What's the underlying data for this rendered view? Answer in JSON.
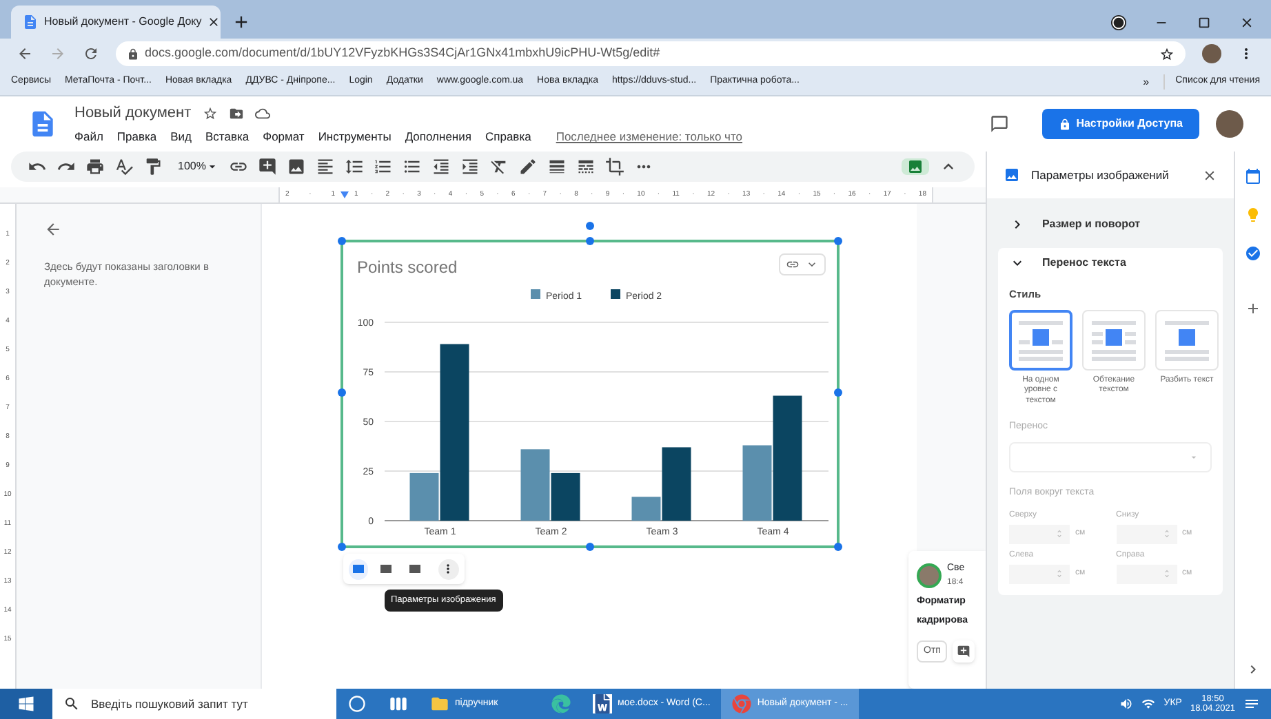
{
  "browser": {
    "tab": {
      "title": "Новый документ - Google Доку"
    },
    "url": "docs.google.com/document/d/1bUY12VFyzbKHGs3S4CjAr1GNx41mbxhU9icPHU-Wt5g/edit#",
    "bookmarks": [
      "Сервисы",
      "МетаПочта - Почт...",
      "Новая вкладка",
      "ДДУВС - Дніпропе...",
      "Login",
      "Додатки",
      "www.google.com.ua",
      "Нова вкладка",
      "https://dduvs-stud...",
      "Практична робота..."
    ],
    "more_bookmarks": "»",
    "reading_list": "Список для чтения"
  },
  "document": {
    "title": "Новый документ",
    "menu": [
      "Файл",
      "Правка",
      "Вид",
      "Вставка",
      "Формат",
      "Инструменты",
      "Дополнения",
      "Справка"
    ],
    "last_edit": "Последнее изменение: только что",
    "share_button": "Настройки Доступа"
  },
  "toolbar": {
    "zoom": "100%"
  },
  "ruler": {
    "top_margin": "2 · 1",
    "top": "1 · 2 · 3 · 4 · 5 · 6 · 7 · 8 · 9 · 10 · 11 · 12 · 13 · 14 · 15 · 16 · 17 · 18",
    "left": "1 2 3 4 5 6 7 8 9 10 11 12 13 14 15"
  },
  "outline": {
    "hint": "Здесь будут показаны заголовки в документе."
  },
  "chart": {
    "chart_data": {
      "type": "bar",
      "title": "Points scored",
      "categories": [
        "Team 1",
        "Team 2",
        "Team 3",
        "Team 4"
      ],
      "series": [
        {
          "name": "Period 1",
          "color": "#5b8fad",
          "values": [
            24,
            36,
            12,
            38
          ]
        },
        {
          "name": "Period 2",
          "color": "#0b4561",
          "values": [
            89,
            24,
            37,
            63
          ]
        }
      ],
      "ylim": [
        0,
        100
      ],
      "yticks": [
        0,
        25,
        50,
        75,
        100
      ],
      "grid": true,
      "legend": true
    }
  },
  "image_toolbar": {
    "wrap_options": [
      {
        "selected": true
      },
      {
        "selected": false
      },
      {
        "selected": false
      }
    ],
    "tooltip": "Параметры изображения"
  },
  "comment": {
    "author": "Све",
    "time": "18:4",
    "lines": [
      "Форматир",
      "кадрирова"
    ],
    "reply": "Отп"
  },
  "image_panel": {
    "title": "Параметры изображений",
    "sections": [
      {
        "label": "Размер и поворот",
        "expanded": false
      },
      {
        "label": "Перенос текста",
        "expanded": true
      }
    ],
    "style_label": "Стиль",
    "styles": [
      {
        "label": "На одном уровне с текстом",
        "selected": true
      },
      {
        "label": "Обтекание текстом",
        "selected": false
      },
      {
        "label": "Разбить текст",
        "selected": false
      }
    ],
    "wrap_label": "Перенос",
    "margins_label": "Поля вокруг текста",
    "margins": [
      {
        "label": "Сверху",
        "unit": "см"
      },
      {
        "label": "Снизу",
        "unit": "см"
      },
      {
        "label": "Слева",
        "unit": "см"
      },
      {
        "label": "Справа",
        "unit": "см"
      }
    ]
  },
  "taskbar": {
    "search_placeholder": "Введіть пошуковий запит тут",
    "apps": [
      {
        "kind": "cortana",
        "selected": false
      },
      {
        "kind": "task-view",
        "selected": false
      },
      {
        "kind": "folder",
        "label": "підручник",
        "selected": false
      },
      {
        "kind": "edge",
        "selected": false
      },
      {
        "kind": "word",
        "label": "мое.docx - Word (C...",
        "selected": false
      },
      {
        "kind": "chrome",
        "label": "Новый документ - ...",
        "selected": true
      }
    ],
    "language": "УКР",
    "time": "18:50",
    "date": "18.04.2021"
  }
}
